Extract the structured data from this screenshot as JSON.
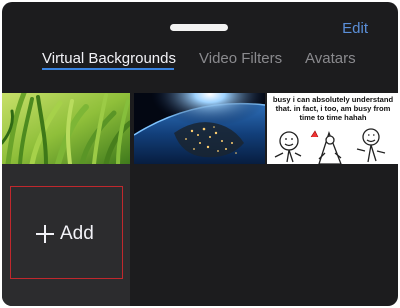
{
  "header": {
    "edit_label": "Edit",
    "accent_color": "#5b8fd9"
  },
  "tabs": [
    {
      "label": "Virtual Backgrounds",
      "active": true
    },
    {
      "label": "Video Filters",
      "active": false
    },
    {
      "label": "Avatars",
      "active": false
    }
  ],
  "backgrounds": [
    {
      "name": "grass",
      "icon": "grass-image"
    },
    {
      "name": "earth-at-night",
      "icon": "earth-night-image"
    },
    {
      "name": "meme",
      "icon": "meme-image",
      "caption": "busy i can absolutely understand that. in fact, i too, am busy from time to time hahah"
    }
  ],
  "add_tile": {
    "label": "Add",
    "icon": "plus-icon",
    "highlight_color": "#c0282d"
  }
}
